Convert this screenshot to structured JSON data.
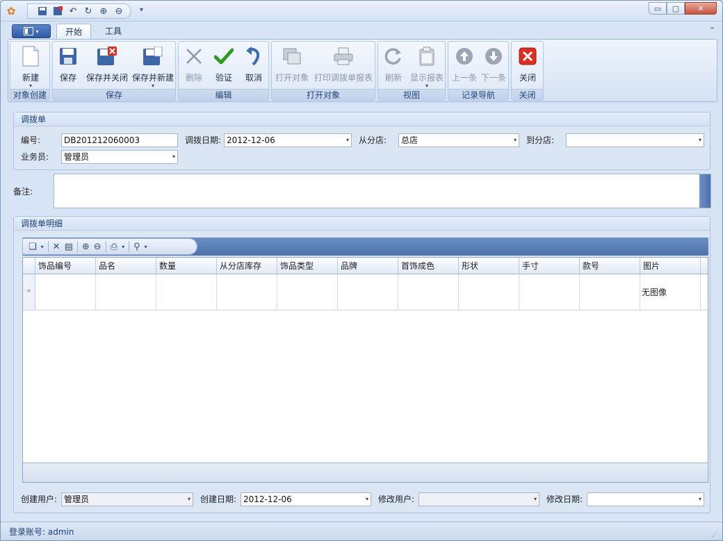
{
  "window": {
    "qat_more": "▾",
    "min_glyph": "▭",
    "max_glyph": "▢",
    "close_glyph": "✕"
  },
  "tabs": [
    {
      "label": "开始"
    },
    {
      "label": "工具"
    }
  ],
  "ribbon_collapse": "⌃",
  "ribbon": {
    "groups": [
      {
        "label": "对象创建"
      },
      {
        "label": "保存"
      },
      {
        "label": "编辑"
      },
      {
        "label": "打开对象"
      },
      {
        "label": "视图"
      },
      {
        "label": "记录导航"
      },
      {
        "label": "关闭"
      }
    ],
    "buttons": {
      "new": "新建",
      "save": "保存",
      "save_close": "保存并关闭",
      "save_new": "保存并新建",
      "delete": "删除",
      "validate": "验证",
      "cancel": "取消",
      "open_object": "打开对象",
      "print_report": "打印调拨单报表",
      "refresh": "刷新",
      "show_report": "显示报表",
      "prev": "上一条",
      "next": "下一条",
      "close": "关闭"
    }
  },
  "form": {
    "section_title": "调拨单",
    "number_label": "编号:",
    "number_value": "DB201212060003",
    "date_label": "调拨日期:",
    "date_value": "2012-12-06",
    "from_store_label": "从分店:",
    "from_store_value": "总店",
    "to_store_label": "到分店:",
    "to_store_value": "",
    "salesperson_label": "业务员:",
    "salesperson_value": "管理员",
    "remark_label": "备注:",
    "remark_value": ""
  },
  "details": {
    "section_title": "调拨单明细",
    "columns": [
      "饰品编号",
      "品名",
      "数量",
      "从分店库存",
      "饰品类型",
      "品牌",
      "首饰成色",
      "形状",
      "手寸",
      "款号",
      "图片"
    ],
    "new_row_indicator": "*",
    "row_image_text": "无图像"
  },
  "footer": {
    "creator_label": "创建用户:",
    "creator_value": "管理员",
    "created_date_label": "创建日期:",
    "created_date_value": "2012-12-06",
    "modifier_label": "修改用户:",
    "modifier_value": "",
    "modified_date_label": "修改日期:",
    "modified_date_value": ""
  },
  "status": {
    "login_label": "登录账号:",
    "login_value": "admin"
  },
  "colors": {
    "accent": "#2d5aa7",
    "close_red": "#c6533d",
    "check_green": "#2e9a1e"
  }
}
